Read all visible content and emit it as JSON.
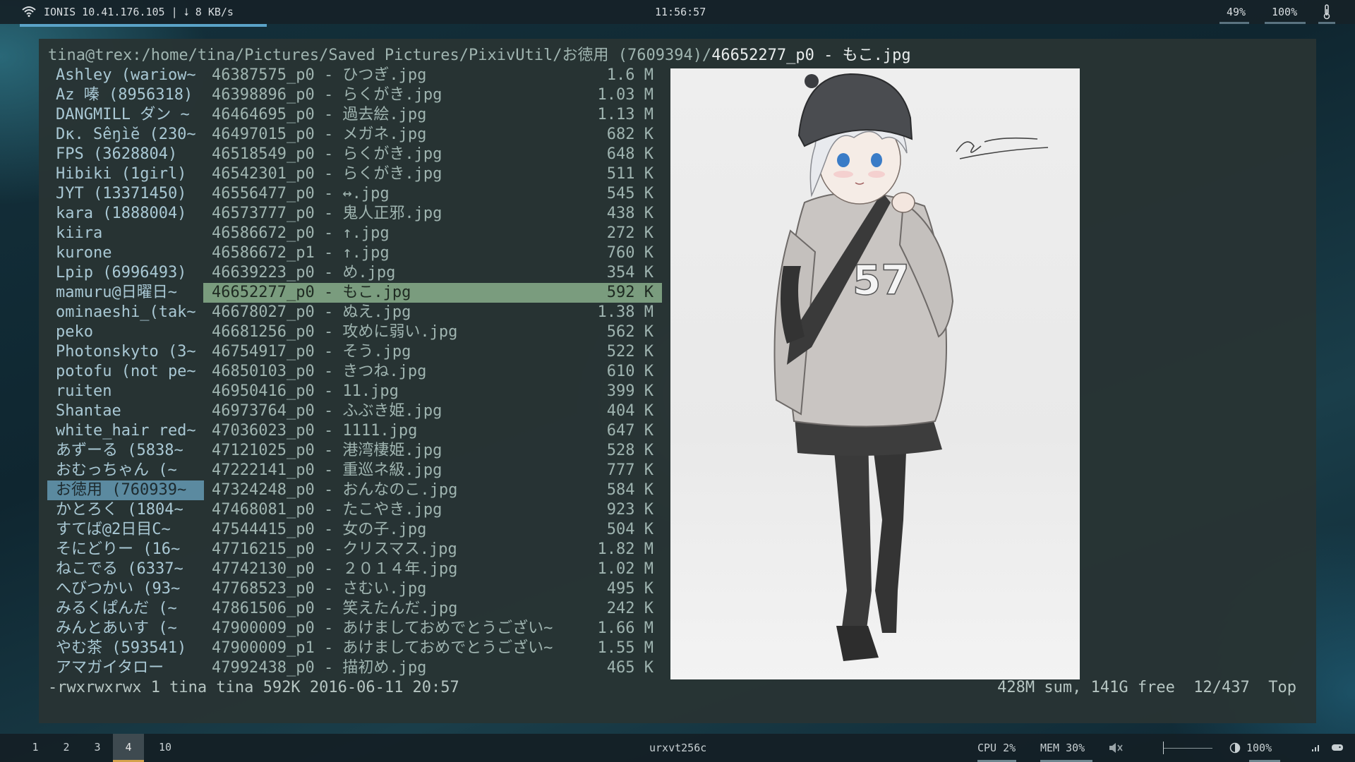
{
  "topbar": {
    "network": "IONIS 10.41.176.105 | ",
    "download": "8 KB/s",
    "clock": "11:56:57",
    "stat1": "49%",
    "stat2": "100%"
  },
  "terminal": {
    "path_prefix": "tina@trex:/home/tina/Pictures/Saved Pictures/PixivUtil/お徳用 (7609394)/",
    "path_current": "46652277_p0 - もこ.jpg",
    "dirs": [
      "Ashley (wariow~",
      "Az 嗪 (8956318)",
      "DANGMILL ダン ~",
      "Dκ. Sêŋìĕ (230~",
      "FPS (3628804)",
      "Hibiki (1girl)",
      "JYT (13371450)",
      "kara (1888004)",
      "kiira",
      "kurone",
      "Lpip (6996493)",
      "mamuru@日曜日~",
      "ominaeshi_(tak~",
      "peko",
      "Photonskyto (3~",
      "potofu (not pe~",
      "ruiten",
      "Shantae",
      "white_hair red~",
      "あずーる (5838~",
      "おむっちゃん (~",
      "お徳用 (760939~",
      "かとろく (1804~",
      "すてば@2日目C~",
      "そにどりー (16~",
      "ねこでる (6337~",
      "へびつかい (93~",
      "みるくぱんだ (~",
      "みんとあいす (~",
      "やむ茶 (593541)",
      "アマガイタロー"
    ],
    "selected_dir_index": 21,
    "files": [
      {
        "name": "46387575_p0 - ひつぎ.jpg",
        "size": "1.6 M"
      },
      {
        "name": "46398896_p0 - らくがき.jpg",
        "size": "1.03 M"
      },
      {
        "name": "46464695_p0 - 過去絵.jpg",
        "size": "1.13 M"
      },
      {
        "name": "46497015_p0 - メガネ.jpg",
        "size": "682 K"
      },
      {
        "name": "46518549_p0 - らくがき.jpg",
        "size": "648 K"
      },
      {
        "name": "46542301_p0 - らくがき.jpg",
        "size": "511 K"
      },
      {
        "name": "46556477_p0 - ↔.jpg",
        "size": "545 K"
      },
      {
        "name": "46573777_p0 - 鬼人正邪.jpg",
        "size": "438 K"
      },
      {
        "name": "46586672_p0 - ↑.jpg",
        "size": "272 K"
      },
      {
        "name": "46586672_p1 - ↑.jpg",
        "size": "760 K"
      },
      {
        "name": "46639223_p0 - め.jpg",
        "size": "354 K"
      },
      {
        "name": "46652277_p0 - もこ.jpg",
        "size": "592 K"
      },
      {
        "name": "46678027_p0 - ぬえ.jpg",
        "size": "1.38 M"
      },
      {
        "name": "46681256_p0 - 攻めに弱い.jpg",
        "size": "562 K"
      },
      {
        "name": "46754917_p0 - そう.jpg",
        "size": "522 K"
      },
      {
        "name": "46850103_p0 - きつね.jpg",
        "size": "610 K"
      },
      {
        "name": "46950416_p0 - 11.jpg",
        "size": "399 K"
      },
      {
        "name": "46973764_p0 - ふぶき姫.jpg",
        "size": "404 K"
      },
      {
        "name": "47036023_p0 - 1111.jpg",
        "size": "647 K"
      },
      {
        "name": "47121025_p0 - 港湾棲姫.jpg",
        "size": "528 K"
      },
      {
        "name": "47222141_p0 - 重巡ネ級.jpg",
        "size": "777 K"
      },
      {
        "name": "47324248_p0 - おんなのこ.jpg",
        "size": "584 K"
      },
      {
        "name": "47468081_p0 - たこやき.jpg",
        "size": "923 K"
      },
      {
        "name": "47544415_p0 - 女の子.jpg",
        "size": "504 K"
      },
      {
        "name": "47716215_p0 - クリスマス.jpg",
        "size": "1.82 M"
      },
      {
        "name": "47742130_p0 - ２０１４年.jpg",
        "size": "1.02 M"
      },
      {
        "name": "47768523_p0 - さむい.jpg",
        "size": "495 K"
      },
      {
        "name": "47861506_p0 - 笑えたんだ.jpg",
        "size": "242 K"
      },
      {
        "name": "47900009_p0 - あけましておめでとうござい~",
        "size": "1.66 M"
      },
      {
        "name": "47900009_p1 - あけましておめでとうござい~",
        "size": "1.55 M"
      },
      {
        "name": "47992438_p0 - 描初め.jpg",
        "size": "465 K"
      }
    ],
    "selected_file_index": 11,
    "status_left": "-rwxrwxrwx 1 tina tina 592K 2016-06-11 20:57",
    "status_right": "428M sum, 141G free  12/437  Top",
    "preview_signature": "2014.10.20"
  },
  "bottombar": {
    "workspaces": [
      "1",
      "2",
      "3",
      "4",
      "10"
    ],
    "active_workspace_index": 3,
    "window_title": "urxvt256c",
    "cpu": "CPU 2%",
    "mem": "MEM 30%",
    "brightness": "100%"
  }
}
